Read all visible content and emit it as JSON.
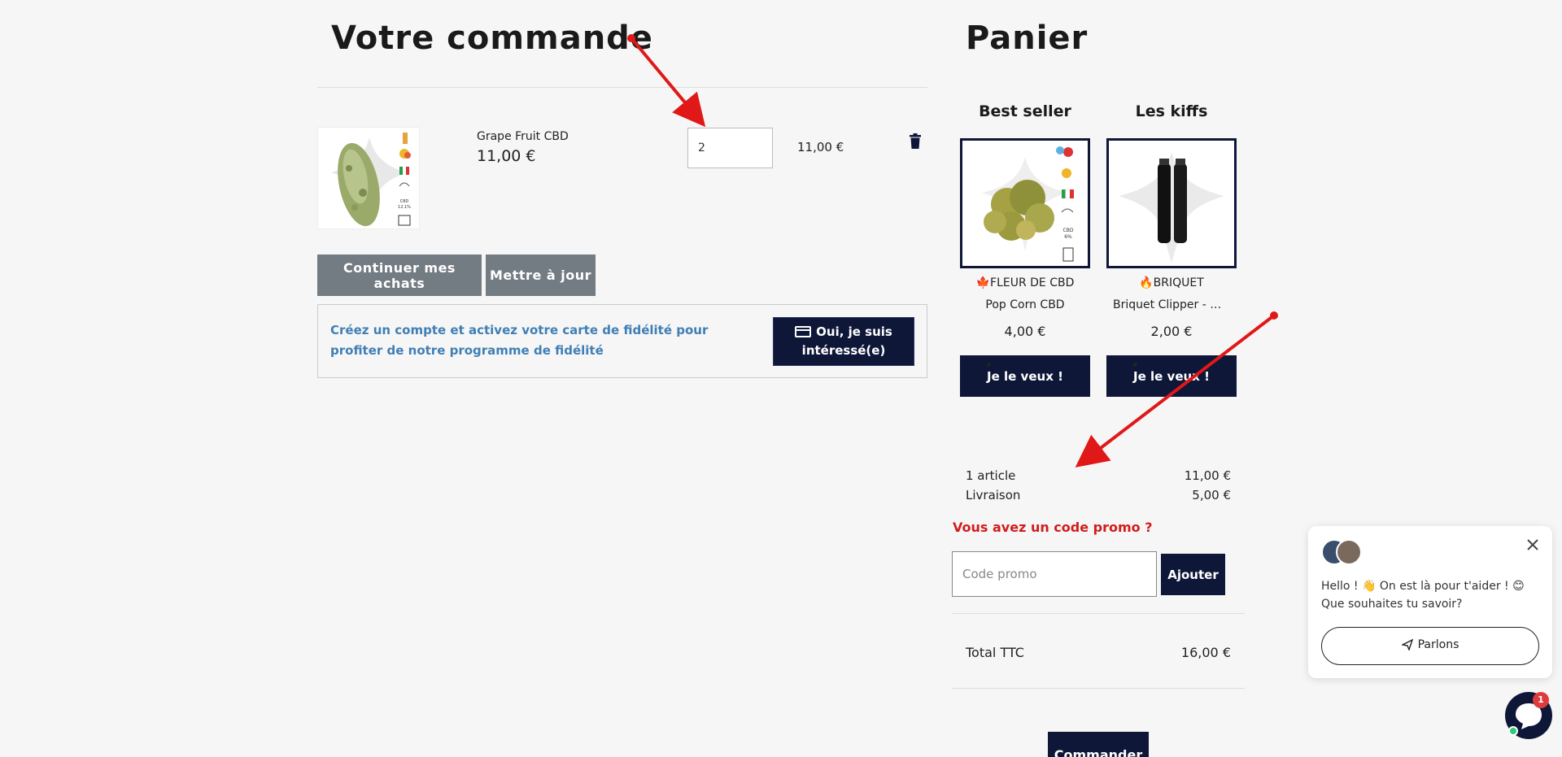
{
  "order": {
    "title": "Votre commande",
    "item": {
      "name": "Grape Fruit CBD",
      "unit_price": "11,00 €",
      "quantity": "2",
      "line_total": "11,00 €"
    },
    "continue_label": "Continuer mes achats",
    "update_label": "Mettre à jour",
    "loyalty_text": "Créez un compte et activez votre carte de fidélité pour profiter de notre programme de fidélité",
    "loyalty_button": "Oui, je suis intéressé(e)"
  },
  "cart": {
    "title": "Panier",
    "recommendations": [
      {
        "heading": "Best seller",
        "category": "🍁FLEUR DE CBD",
        "name": "Pop Corn CBD",
        "price": "4,00 €",
        "button": "Je le veux !"
      },
      {
        "heading": "Les kiffs",
        "category": "🔥BRIQUET",
        "name": "Briquet Clipper - Ga...",
        "price": "2,00 €",
        "button": "Je le veux !"
      }
    ],
    "summary": {
      "articles_label": "1 article",
      "articles_value": "11,00 €",
      "delivery_label": "Livraison",
      "delivery_value": "5,00 €"
    },
    "promo": {
      "title": "Vous avez un code promo ?",
      "placeholder": "Code promo",
      "button": "Ajouter"
    },
    "total": {
      "label": "Total TTC",
      "value": "16,00 €"
    },
    "order_button": "Commander"
  },
  "chat": {
    "message": "Hello ! 👋 On est là pour t'aider ! 😊 Que souhaites tu savoir?",
    "button": "Parlons",
    "badge": "1"
  },
  "colors": {
    "navy": "#0e1738",
    "promo_red": "#d21c1c",
    "loyalty_blue": "#3f7fb5",
    "grey_button": "#737b83"
  }
}
